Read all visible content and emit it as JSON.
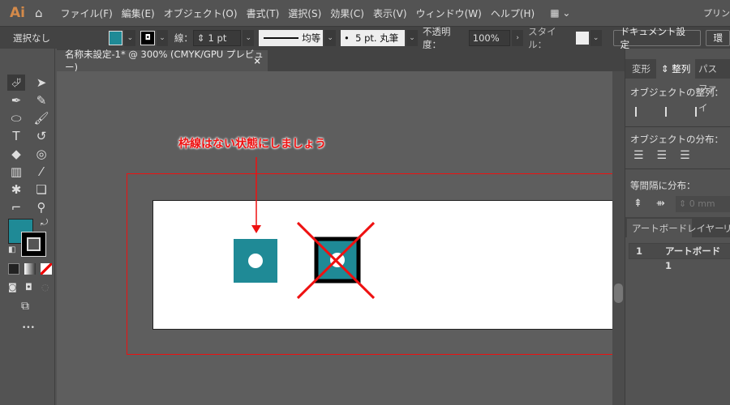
{
  "app": {
    "logo": "Ai"
  },
  "menu": [
    "ファイル(F)",
    "編集(E)",
    "オブジェクト(O)",
    "書式(T)",
    "選択(S)",
    "効果(C)",
    "表示(V)",
    "ウィンドウ(W)",
    "ヘルプ(H)"
  ],
  "menu_right": "プリン",
  "control": {
    "selection": "選択なし",
    "stroke_label": "線：",
    "stroke_value": "1 pt",
    "profile": "均等",
    "brush": "5 pt. 丸筆",
    "opacity_label": "不透明度：",
    "opacity": "100%",
    "style_label": "スタイル：",
    "doc_setup": "ドキュメント設定",
    "prefs": "環"
  },
  "document_tab": {
    "title": "名称未設定-1* @ 300% (CMYK/GPU プレビュー)",
    "close": "×"
  },
  "canvas": {
    "annotation": "枠線はない状態にしましょう"
  },
  "colors": {
    "fill": "#1f8a96",
    "accent_red": "#ee1111"
  },
  "panel": {
    "tabs": [
      "変形",
      "整列",
      "パスファイ"
    ],
    "align_objects": "オブジェクトの整列：",
    "distribute_objects": "オブジェクトの分布：",
    "distribute_spacing": "等間隔に分布：",
    "spacing_value": "0 mm",
    "tabs2": [
      "アートボード",
      "レイヤー",
      "リ"
    ],
    "artboard_row": {
      "num": "1",
      "name": "アートボード 1"
    }
  },
  "toolbar": {
    "more": "•••"
  }
}
